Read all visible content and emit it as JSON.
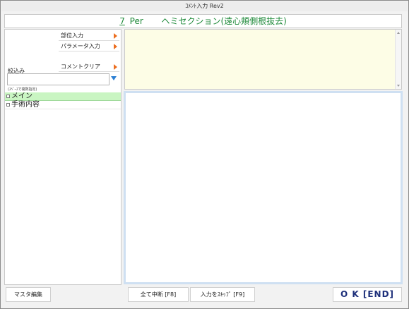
{
  "window": {
    "title": "ｺﾒﾝﾄ入力 Rev2"
  },
  "header": {
    "number": "7",
    "code": "Per",
    "procedure": "ヘミセクション(遠心頬側根抜去)"
  },
  "left_panel": {
    "buttons": [
      {
        "label": "部位入力"
      },
      {
        "label": "パラメータ入力"
      },
      {
        "label": "コメントクリア"
      }
    ],
    "filter": {
      "label": "絞込み",
      "value": "",
      "placeholder": "",
      "hint": "(ｽﾍﾟｰｽで複数指定)"
    },
    "tree": [
      {
        "label": "メイン",
        "selected": true
      },
      {
        "label": "手術内容",
        "selected": false
      }
    ]
  },
  "footer": {
    "master_edit": "マスタ編集",
    "abort_all": "全て中断 [F8]",
    "skip_input": "入力をｽｷｯﾌﾟ [F9]",
    "ok": "O K  [END]"
  },
  "colors": {
    "header_text": "#1f8a3a",
    "arrow": "#ec6e1f",
    "dropdown": "#2b7fd3",
    "selected_row": "#c9f5c2",
    "comment_bg": "#fdfde6",
    "ok_text": "#1d2f7a"
  },
  "icons": {
    "button_arrow": "play-arrow-icon",
    "dropdown": "dropdown-triangle-icon",
    "tree_checkbox": "checkbox-icon"
  }
}
